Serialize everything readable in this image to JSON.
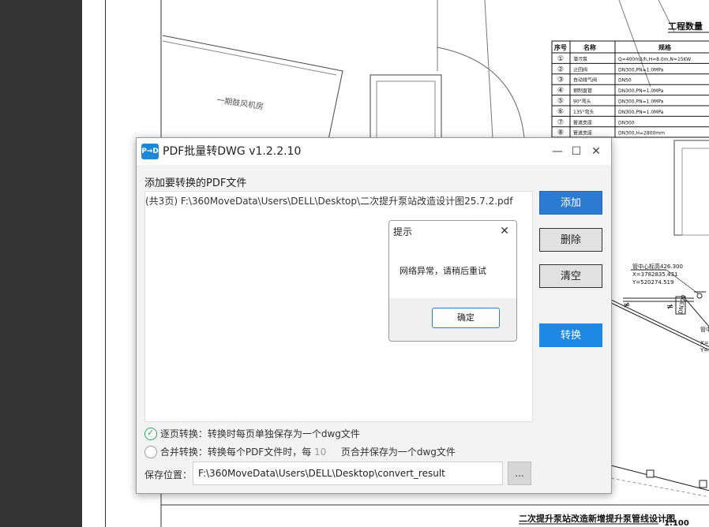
{
  "window": {
    "icon_text": "P→D",
    "title": "PDF批量转DWG  v1.2.2.10",
    "minimize": "—",
    "maximize": "☐",
    "close": "✕"
  },
  "drawing": {
    "table_title": "工程数量",
    "col_seq": "序号",
    "col_name": "名称",
    "col_spec": "规格",
    "rows": [
      {
        "no": "①",
        "name": "潜污泵",
        "spec": "Q=400m3/h,H=8.0m,N=15KW"
      },
      {
        "no": "②",
        "name": "止回阀",
        "spec": "DN300,PN=1.0MPa"
      },
      {
        "no": "③",
        "name": "自动排气阀",
        "spec": "DN50"
      },
      {
        "no": "④",
        "name": "钢制直管",
        "spec": "DN300,PN=1.0MPa"
      },
      {
        "no": "⑤",
        "name": "90°弯头",
        "spec": "DN300,PN=1.0MPa"
      },
      {
        "no": "⑥",
        "name": "135°弯头",
        "spec": "DN300,PN=1.0MPa"
      },
      {
        "no": "⑦",
        "name": "管道支座",
        "spec": "DN300"
      },
      {
        "no": "⑧",
        "name": "管道支座",
        "spec": "DN300,H=2800mm"
      }
    ],
    "fan_room": "一期鼓风机房",
    "coord1_a": "管中心标高426.300",
    "coord1_b": "X=3782835.431",
    "coord1_c": "Y=520274.519",
    "dn_label": "DN300",
    "coord2_a": "管中",
    "coord2_b": "X=3",
    "coord2_c": "Y=5",
    "bottom_title": "二次提升泵站改造新增提升泵管线设计图",
    "scale": "1:100"
  },
  "main": {
    "section_label": "添加要转换的PDF文件",
    "files": [
      "(共3页) F:\\360MoveData\\Users\\DELL\\Desktop\\二次提升泵站改造设计图25.7.2.pdf"
    ],
    "buttons": {
      "add": "添加",
      "delete": "删除",
      "clear": "清空",
      "convert": "转换"
    },
    "options": {
      "per_page": "逐页转换：转换时每页单独保存为一个dwg文件",
      "merge_prefix": "合并转换：转换每个PDF文件时，每",
      "merge_pages": "10",
      "merge_suffix": "页合并保存为一个dwg文件"
    },
    "save_label": "保存位置：",
    "save_path": "F:\\360MoveData\\Users\\DELL\\Desktop\\convert_result",
    "browse": "..."
  },
  "dialog": {
    "title": "提示",
    "close": "✕",
    "message": "网络异常，请稍后重试",
    "ok": "确定"
  }
}
